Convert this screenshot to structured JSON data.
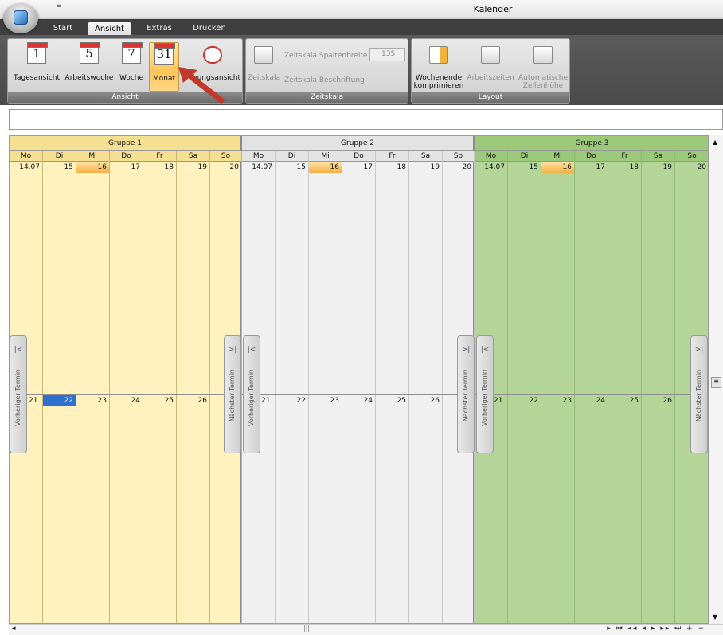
{
  "window": {
    "title": "Kalender",
    "qat": "="
  },
  "tabs": [
    "Start",
    "Ansicht",
    "Extras",
    "Drucken"
  ],
  "ribbon": {
    "ansicht": {
      "label": "Ansicht",
      "buttons": [
        {
          "label": "Tagesansicht",
          "icon": "1"
        },
        {
          "label": "Arbeitswoche",
          "icon": "5"
        },
        {
          "label": "Woche",
          "icon": "7"
        },
        {
          "label": "Monat",
          "icon": "31"
        },
        {
          "label": "hungsansicht",
          "icon": "timeline-icon"
        }
      ]
    },
    "zeitskala": {
      "label": "Zeitskala",
      "zeitskala": "Zeitskala",
      "spaltenbreite": "Zeitskala Spaltenbreite",
      "spaltenbreite_value": "135",
      "beschriftung": "Zeitskala Beschriftung"
    },
    "layout": {
      "label": "Layout",
      "wochenende": "Wochenende komprimieren",
      "arbeitszeiten": "Arbeitszeiten",
      "zellenhoehe": "Automatische Zellenhöhe"
    }
  },
  "scheduler": {
    "groups": [
      {
        "name": "Gruppe 1",
        "color": "#fff2bf"
      },
      {
        "name": "Gruppe 2",
        "color": "#f0f0f0"
      },
      {
        "name": "Gruppe 3",
        "color": "#b3d597"
      }
    ],
    "days": [
      "Mo",
      "Di",
      "Mi",
      "Do",
      "Fr",
      "Sa",
      "So"
    ],
    "week1": [
      "14.07",
      "15",
      "16",
      "17",
      "18",
      "19",
      "20"
    ],
    "week2": [
      "21",
      "22",
      "23",
      "24",
      "25",
      "26"
    ],
    "prev": "Vorheriger Termin",
    "next": "Nächster Termin"
  }
}
